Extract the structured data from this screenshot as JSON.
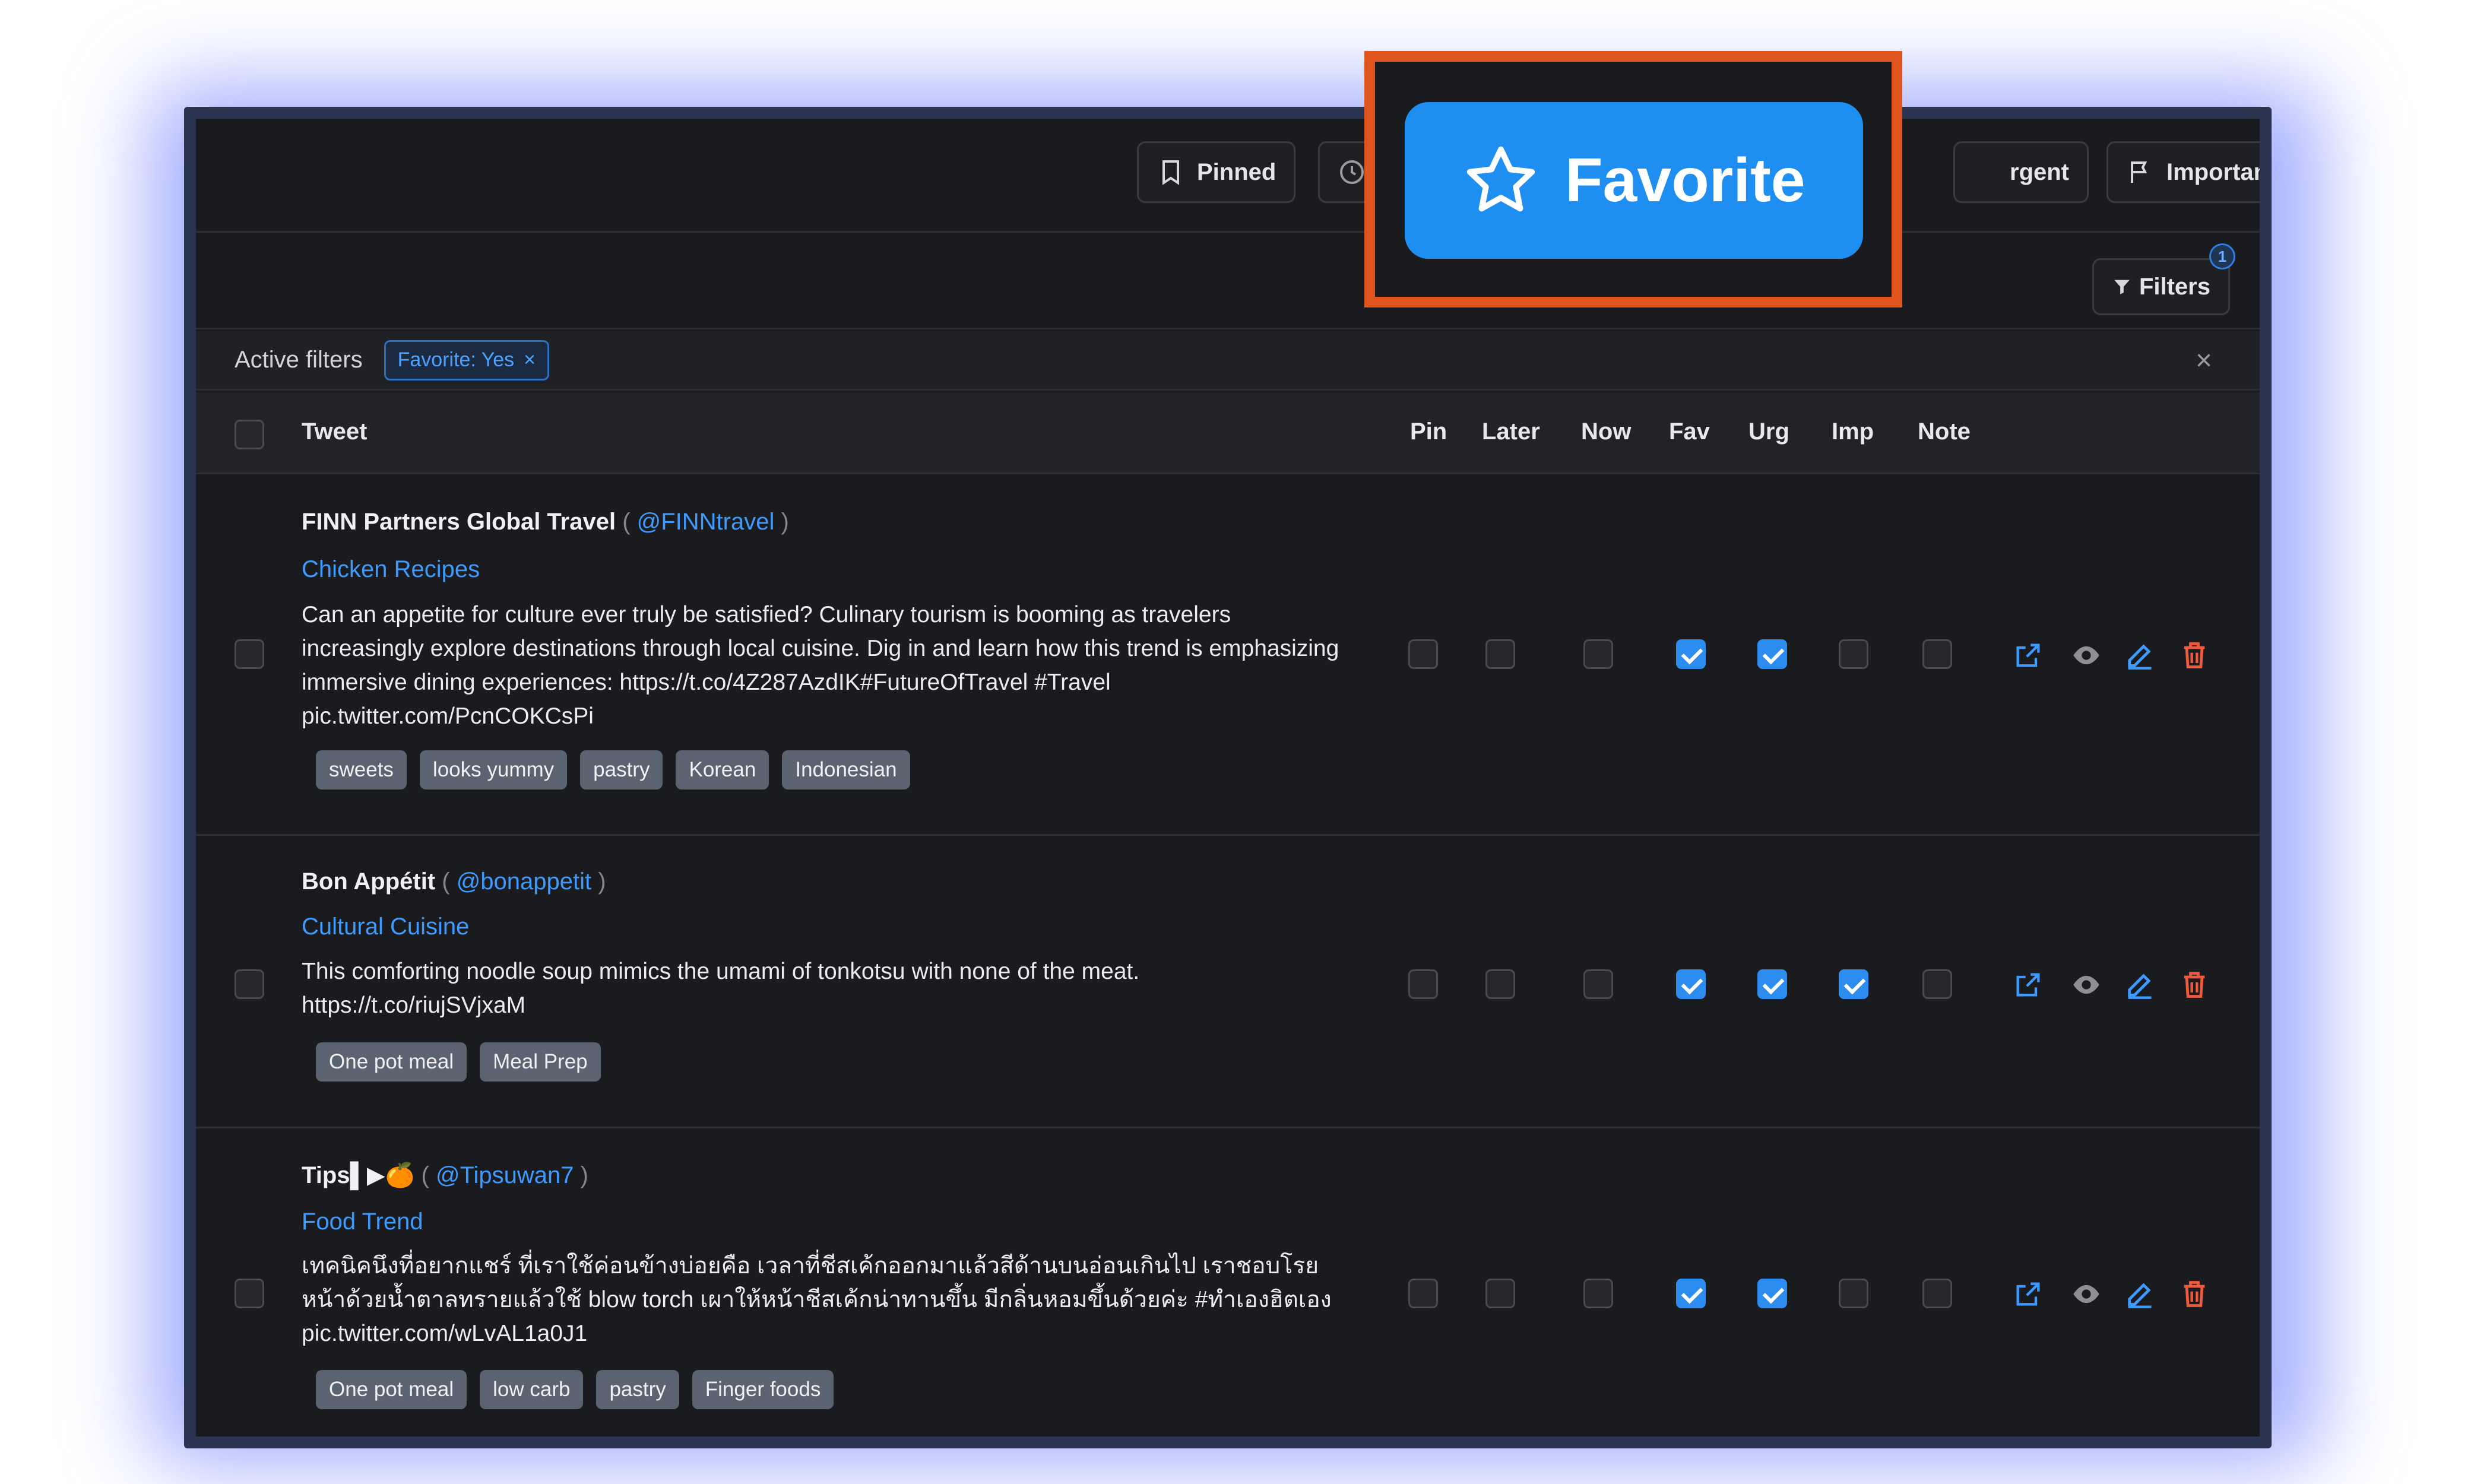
{
  "toolbar": {
    "pinned": "Pinned",
    "urgent_partial": "rgent",
    "important": "Important"
  },
  "callout": {
    "label": "Favorite"
  },
  "filters": {
    "label": "Filters",
    "count": "1"
  },
  "active_filters": {
    "label": "Active filters",
    "chip": "Favorite: Yes",
    "chip_remove": "×",
    "clear": "×"
  },
  "table": {
    "columns": [
      "Tweet",
      "Pin",
      "Later",
      "Now",
      "Fav",
      "Urg",
      "Imp",
      "Note"
    ],
    "rows": [
      {
        "author": "FINN Partners Global Travel",
        "handle": "@FINNtravel",
        "category": "Chicken Recipes",
        "text": "Can an appetite for culture ever truly be satisfied? Culinary tourism is booming as travelers increasingly explore destinations through local cuisine. Dig in and learn how this trend is emphasizing immersive dining experiences: https://t.co/4Z287AzdIK#FutureOfTravel #Travel pic.twitter.com/PcnCOKCsPi",
        "tags": [
          "sweets",
          "looks yummy",
          "pastry",
          "Korean",
          "Indonesian"
        ],
        "flags": {
          "pin": false,
          "later": false,
          "now": false,
          "fav": true,
          "urg": true,
          "imp": false,
          "note": false
        }
      },
      {
        "author": "Bon Appétit",
        "handle": "@bonappetit",
        "category": "Cultural Cuisine",
        "text": "This comforting noodle soup mimics the umami of tonkotsu with none of the meat. https://t.co/riujSVjxaM",
        "tags": [
          "One pot meal",
          "Meal Prep"
        ],
        "flags": {
          "pin": false,
          "later": false,
          "now": false,
          "fav": true,
          "urg": true,
          "imp": true,
          "note": false
        }
      },
      {
        "author": "Tips▌▶🍊",
        "handle": "@Tipsuwan7",
        "category": "Food Trend",
        "text": "เทคนิคนึงที่อยากแชร์ ที่เราใช้ค่อนข้างบ่อยคือ เวลาที่ชีสเค้กออกมาแล้วสีด้านบนอ่อนเกินไป เราชอบโรยหน้าด้วยน้ำตาลทรายแล้วใช้ blow torch เผาให้หน้าชีสเค้กน่าทานขึ้น มีกลิ่นหอมขึ้นด้วยค่ะ #ทำเองฮิตเอง pic.twitter.com/wLvAL1a0J1",
        "tags": [
          "One pot meal",
          "low carb",
          "pastry",
          "Finger foods"
        ],
        "flags": {
          "pin": false,
          "later": false,
          "now": false,
          "fav": true,
          "urg": true,
          "imp": false,
          "note": false
        }
      }
    ]
  },
  "row_actions": [
    "external-link-icon",
    "eye-icon",
    "edit-icon",
    "trash-icon"
  ],
  "colors": {
    "accent": "#2d8cf0",
    "callout_border": "#e0541e",
    "link": "#3d9bff",
    "delete": "#f05a3c",
    "panel_bg": "#1a1b1e"
  }
}
